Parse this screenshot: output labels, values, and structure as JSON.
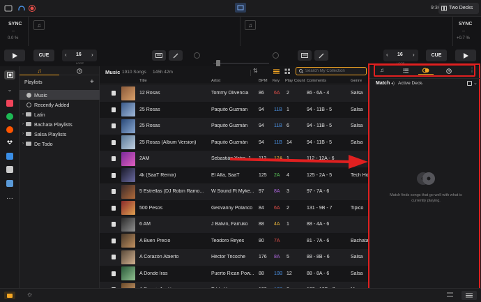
{
  "topbar": {
    "time": "9:36PM",
    "decks_label": "Two Decks"
  },
  "deck_left": {
    "sync": "SYNC",
    "pitch": "0.0 %",
    "pitch_dash": "--",
    "cue": "CUE",
    "loop_size": "16",
    "loop_label": "LOOP"
  },
  "deck_right": {
    "sync": "SYNC",
    "pitch": "+0.7 %",
    "pitch_dash": "--",
    "cue": "CUE",
    "loop_size": "16",
    "loop_label": "LOOP"
  },
  "playlists": {
    "header": "Playlists",
    "items": [
      {
        "label": "Music",
        "active": true
      },
      {
        "label": "Recently Added"
      },
      {
        "label": "Latin"
      },
      {
        "label": "Bachata Playlists"
      },
      {
        "label": "Salsa Playlists"
      },
      {
        "label": "De Todo"
      }
    ]
  },
  "library": {
    "title": "Music",
    "count": "1910 Songs",
    "duration": "145h 42m",
    "search_placeholder": "Search My Collection",
    "columns": [
      "Title",
      "Artist",
      "BPM",
      "Key",
      "Play Count",
      "Comments",
      "Genre"
    ],
    "rows": [
      {
        "title": "12 Rosas",
        "artist": "Tommy Olivencia",
        "bpm": "86",
        "key": "6A",
        "plays": "2",
        "comments": "86 - 6A - 4",
        "genre": "Salsa"
      },
      {
        "title": "25 Rosas",
        "artist": "Paquito Guzman",
        "bpm": "94",
        "key": "11B",
        "plays": "1",
        "comments": "94 - 11B - 5",
        "genre": "Salsa"
      },
      {
        "title": "25 Rosas",
        "artist": "Paquito Guzmán",
        "bpm": "94",
        "key": "11B",
        "plays": "6",
        "comments": "94 - 11B - 5",
        "genre": "Salsa"
      },
      {
        "title": "25 Rosas (Album Version)",
        "artist": "Paquito Guzmán",
        "bpm": "94",
        "key": "11B",
        "plays": "14",
        "comments": "94 - 11B - 5",
        "genre": "Salsa"
      },
      {
        "title": "2AM",
        "artist": "Sebastián Yatra, J",
        "bpm": "112",
        "key": "12A",
        "plays": "1",
        "comments": "112 - 12A - 6",
        "genre": ""
      },
      {
        "title": "4k (SaaT Remix)",
        "artist": "El Alfa, SaaT",
        "bpm": "125",
        "key": "2A",
        "plays": "4",
        "comments": "125 - 2A - 5",
        "genre": "Tech House"
      },
      {
        "title": "5 Estrellas (DJ Robin Ramo...",
        "artist": "W Sound Ft Myke...",
        "bpm": "97",
        "key": "8A",
        "plays": "3",
        "comments": "97 - 7A - 6",
        "genre": ""
      },
      {
        "title": "500 Pesos",
        "artist": "Geovanny Polanco",
        "bpm": "84",
        "key": "6A",
        "plays": "2",
        "comments": "131 - 9B - 7",
        "genre": "Tipico"
      },
      {
        "title": "6 AM",
        "artist": "J Balvin, Farruko",
        "bpm": "88",
        "key": "4A",
        "plays": "1",
        "comments": "88 - 4A - 6",
        "genre": ""
      },
      {
        "title": "A Buen Precio",
        "artist": "Teodoro Reyes",
        "bpm": "80",
        "key": "7A",
        "plays": "",
        "comments": "81 - 7A - 6",
        "genre": "Bachata"
      },
      {
        "title": "A Corazón Abierto",
        "artist": "Héctor Tricoche",
        "bpm": "176",
        "key": "8A",
        "plays": "5",
        "comments": "88 - 8B - 6",
        "genre": "Salsa"
      },
      {
        "title": "A Donde Iras",
        "artist": "Puerto Rican Pow...",
        "bpm": "88",
        "key": "10B",
        "plays": "12",
        "comments": "88 - 8A - 6",
        "genre": "Salsa"
      },
      {
        "title": "A Dormir Juntitos",
        "artist": "Eddy Herrera",
        "bpm": "122",
        "key": "12B",
        "plays": "2",
        "comments": "122 - 12B - 7",
        "genre": "Merengue"
      }
    ]
  },
  "right_panel": {
    "match_label": "Match",
    "source_label": "Active Deck",
    "empty_message": "Match finds songs that go well with what is currently playing."
  },
  "colors": {
    "accent": "#f5a623",
    "highlight": "#e02020",
    "key_red": "#e8504a",
    "key_blue": "#4a90e2",
    "key_green": "#5ac85a",
    "key_purple": "#b067e0",
    "key_yellow": "#e8b43a"
  }
}
